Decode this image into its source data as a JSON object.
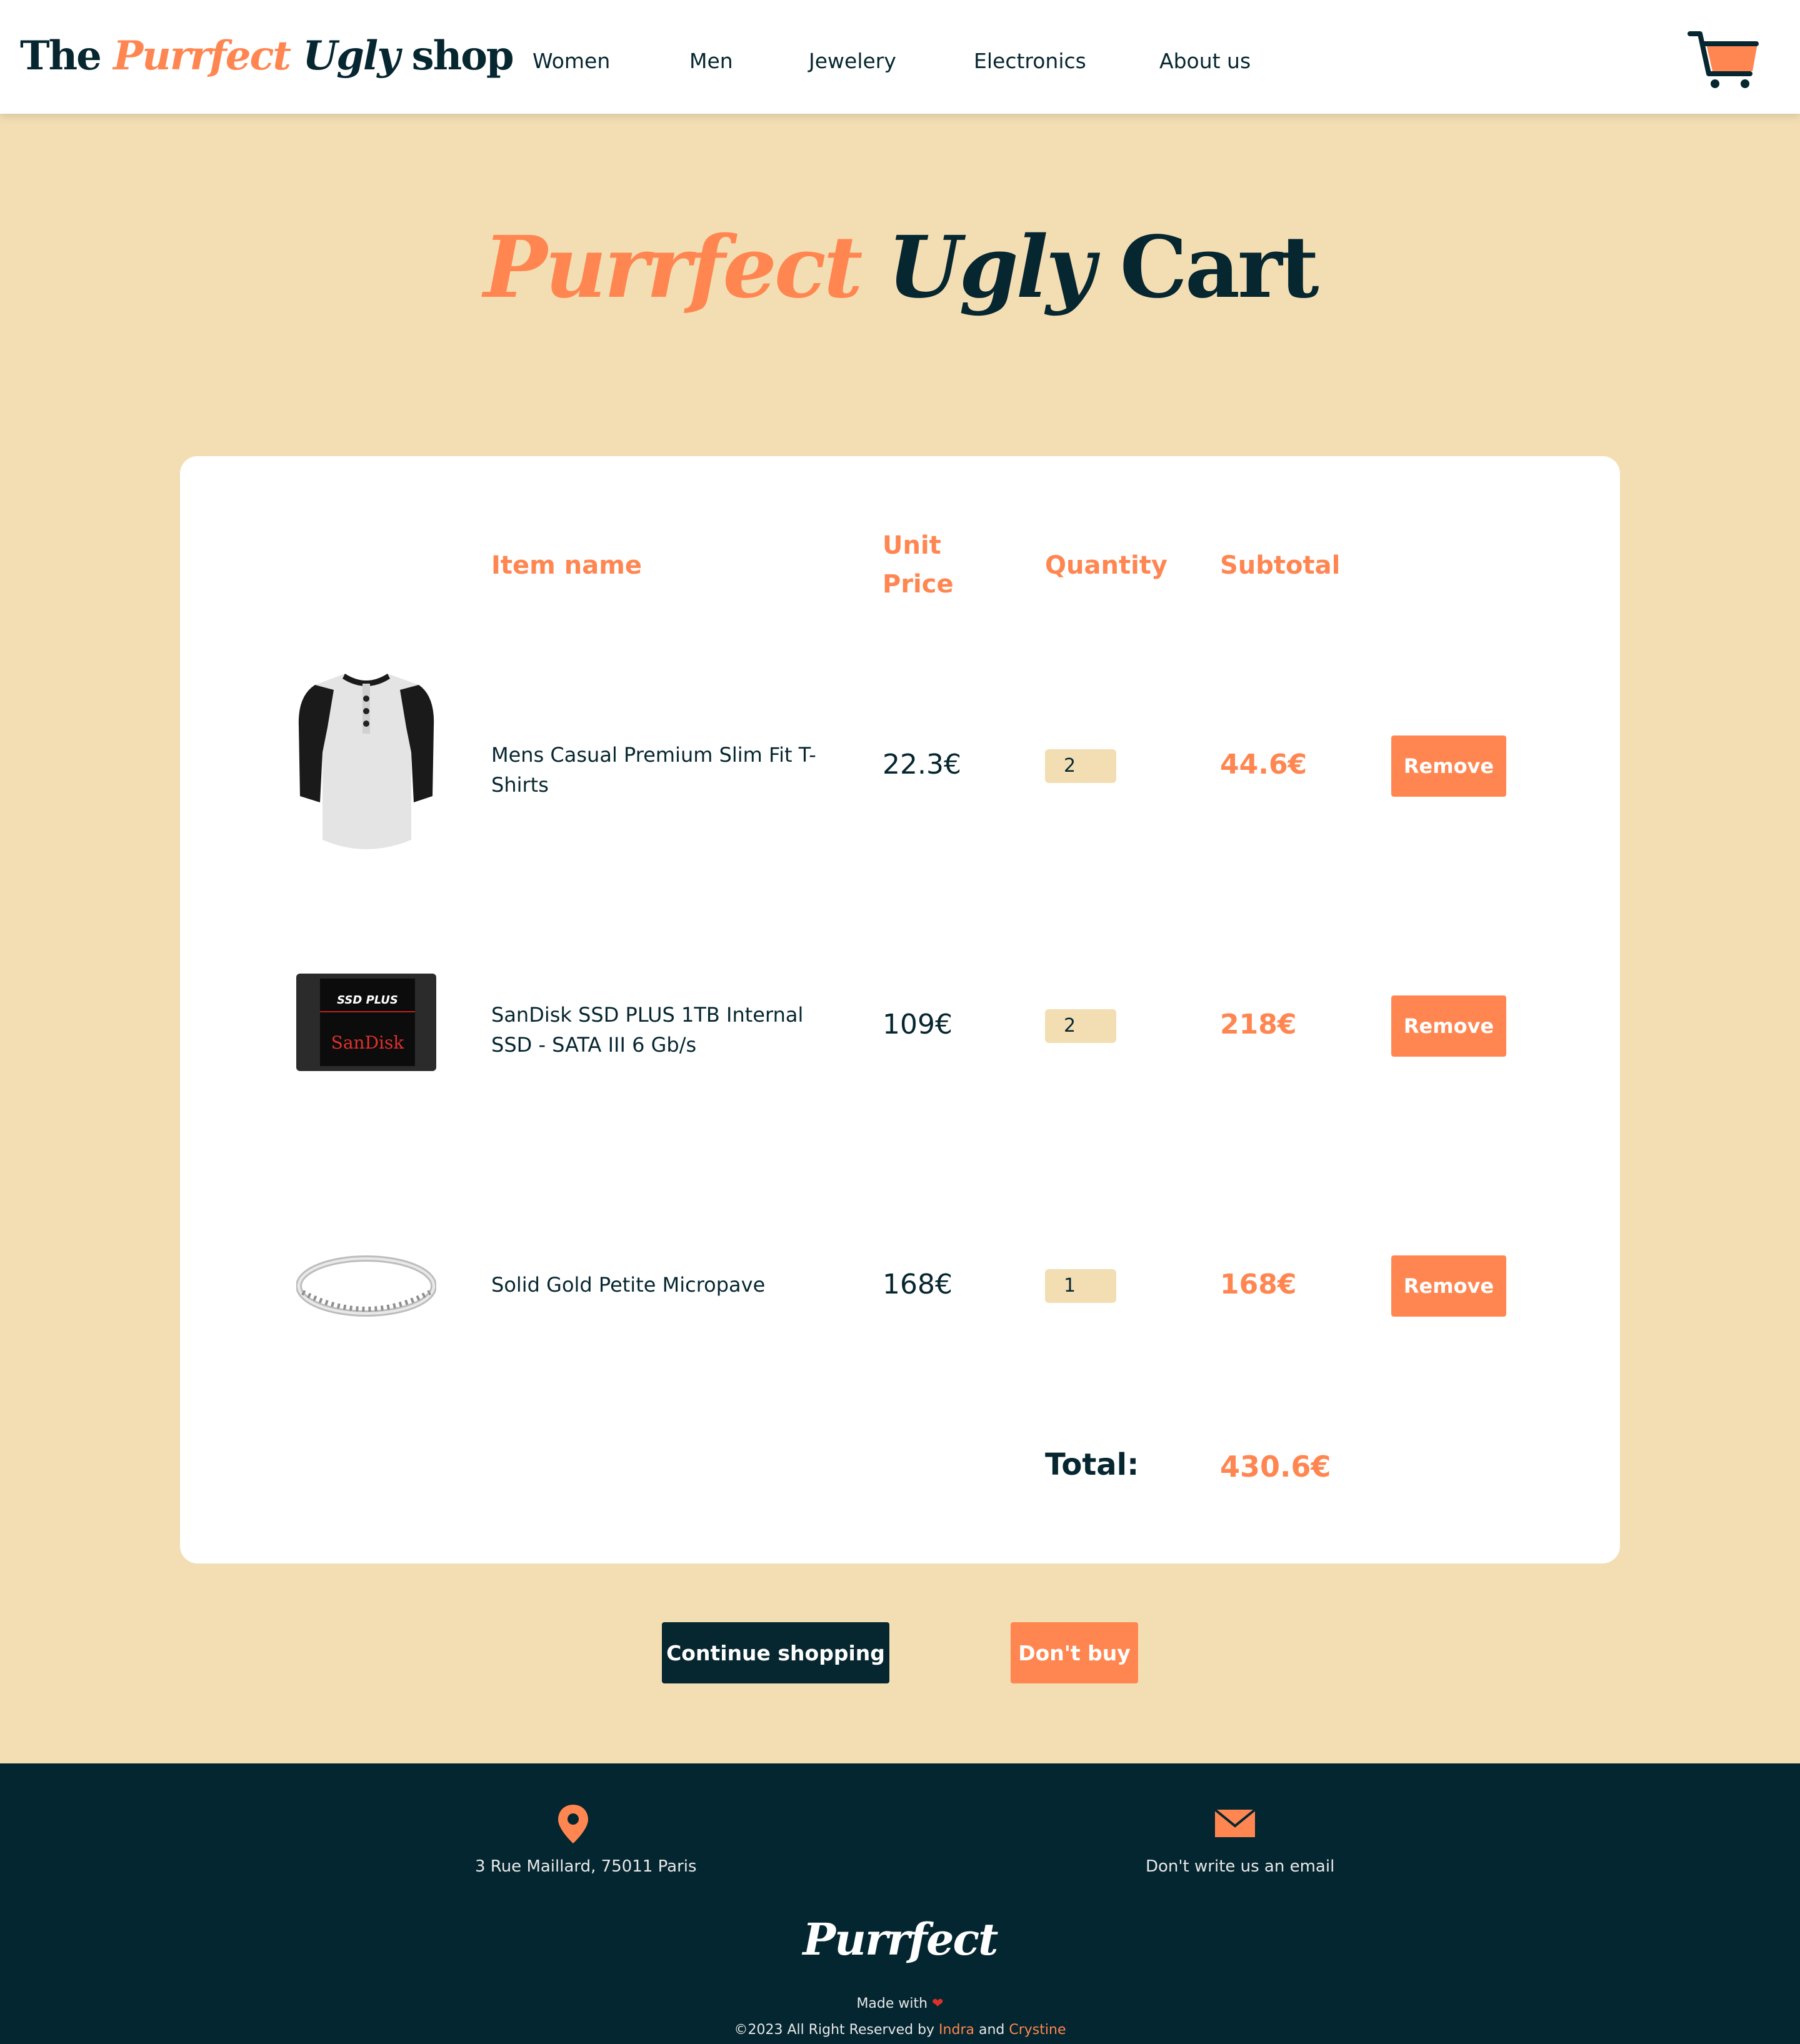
{
  "header": {
    "logo": {
      "part1": "The ",
      "part2": "Purrfect",
      "part3": " Ugly",
      "part4": " shop"
    },
    "nav": [
      "Women",
      "Men",
      "Jewelery",
      "Electronics",
      "About us"
    ]
  },
  "hero": {
    "word1": "Purrfect",
    "word2": " Ugly",
    "word3": " Cart"
  },
  "table": {
    "headers": {
      "item_name": "Item name",
      "unit_price_line1": "Unit",
      "unit_price_line2": "Price",
      "quantity": "Quantity",
      "subtotal": "Subtotal"
    },
    "rows": [
      {
        "name": "Mens Casual Premium Slim Fit T-Shirts",
        "unit_price": "22.3€",
        "quantity": "2",
        "subtotal": "44.6€",
        "remove": "Remove",
        "image": "tshirt-image"
      },
      {
        "name": "SanDisk SSD PLUS 1TB Internal SSD - SATA III 6 Gb/s",
        "unit_price": "109€",
        "quantity": "2",
        "subtotal": "218€",
        "remove": "Remove",
        "image": "ssd-image",
        "image_text": {
          "top": "SSD PLUS",
          "brand": "SanDisk"
        }
      },
      {
        "name": "Solid Gold Petite Micropave",
        "unit_price": "168€",
        "quantity": "1",
        "subtotal": "168€",
        "remove": "Remove",
        "image": "ring-image"
      }
    ],
    "total_label": "Total:",
    "total_value": "430.6€"
  },
  "actions": {
    "continue": "Continue shopping",
    "dont_buy": "Don't buy"
  },
  "footer": {
    "address": "3 Rue Maillard, 75011 Paris",
    "email": "Don't write us an email",
    "logo": "Purrfect",
    "made_with": "Made with",
    "copyright_prefix": "©2023 All Right Reserved by ",
    "author1": "Indra",
    "and": " and ",
    "author2": "Crystine"
  },
  "colors": {
    "accent": "#ff8651",
    "navy": "#062630",
    "background": "#f3deb4",
    "footer": "#042630"
  },
  "icons": [
    "cart-icon",
    "location-pin-icon",
    "mail-icon",
    "heart-icon"
  ]
}
